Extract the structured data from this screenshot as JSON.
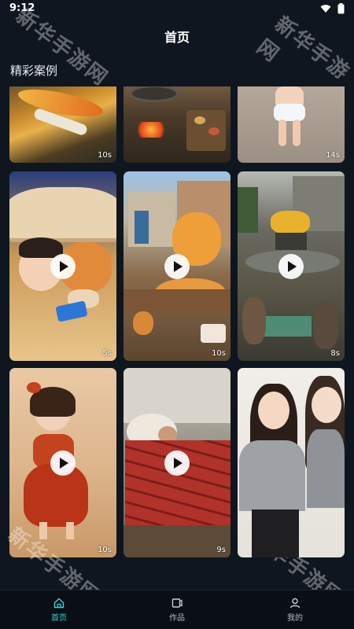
{
  "status": {
    "time": "9:12"
  },
  "header": {
    "title": "首页"
  },
  "section": {
    "title": "精彩案例"
  },
  "tiles": [
    {
      "duration": "10s"
    },
    {
      "duration": ""
    },
    {
      "duration": "14s"
    },
    {
      "duration": "5s"
    },
    {
      "duration": "10s"
    },
    {
      "duration": "8s"
    },
    {
      "duration": "10s"
    },
    {
      "duration": "9s"
    },
    {
      "duration": ""
    }
  ],
  "watermark": {
    "text": "新华手游网"
  },
  "nav": [
    {
      "label": "首页",
      "icon": "home-icon",
      "active": true
    },
    {
      "label": "作品",
      "icon": "works-icon",
      "active": false
    },
    {
      "label": "我的",
      "icon": "profile-icon",
      "active": false
    }
  ],
  "colors": {
    "accent": "#31d4d2",
    "background": "#0f1620"
  }
}
